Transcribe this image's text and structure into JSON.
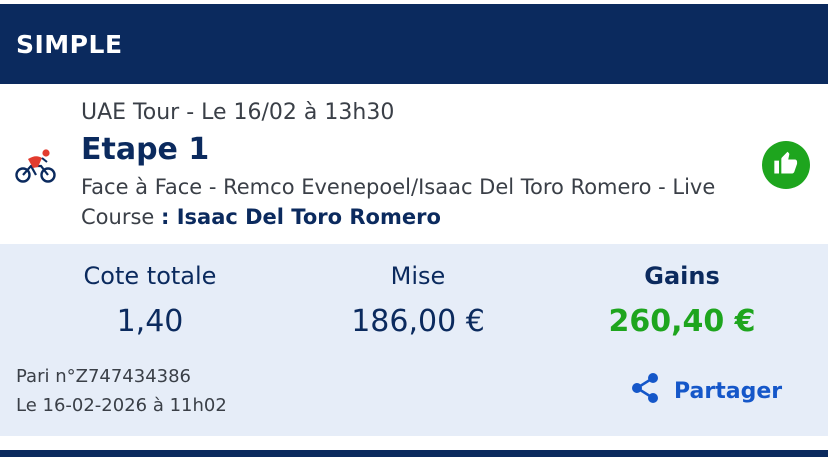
{
  "header": {
    "title": "SIMPLE"
  },
  "event": {
    "meta": "UAE Tour - Le 16/02 à 13h30",
    "name": "Etape 1",
    "market": "Face à Face - Remco Evenepoel/Isaac Del Toro Romero - Live Course ",
    "selection": ": Isaac Del Toro Romero",
    "sport_icon": "cycling-icon",
    "like_icon": "thumbs-up-icon"
  },
  "summary": {
    "odds_label": "Cote totale",
    "odds_value": "1,40",
    "stake_label": "Mise",
    "stake_value": "186,00 €",
    "winnings_label": "Gains",
    "winnings_value": "260,40 €"
  },
  "bet": {
    "ref": "Pari n°Z747434386",
    "date": "Le 16-02-2026 à 11h02"
  },
  "share": {
    "label": "Partager",
    "icon": "share-icon"
  },
  "colors": {
    "brand_navy": "#0b2a5e",
    "win_green": "#1ea51e",
    "link_blue": "#1557c9",
    "summary_bg": "#e6edf8"
  }
}
